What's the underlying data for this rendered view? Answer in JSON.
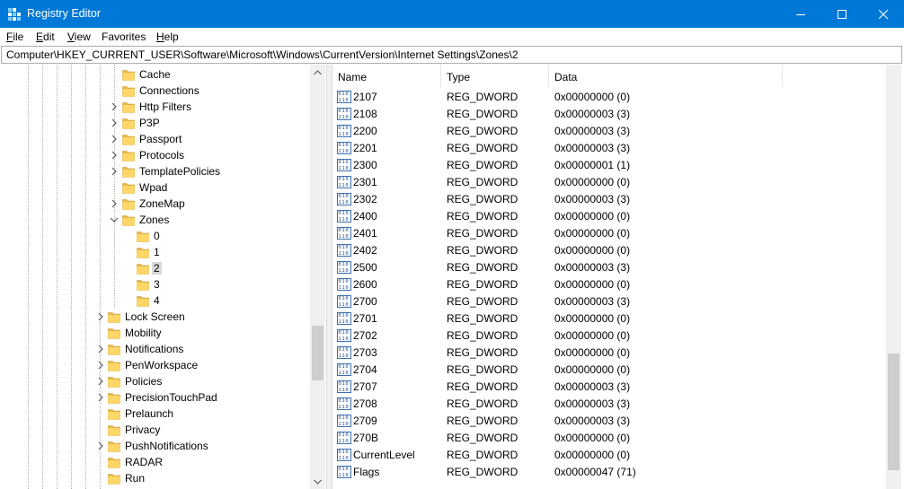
{
  "window": {
    "title": "Registry Editor",
    "controls": {
      "minimize": "minimize",
      "maximize": "maximize",
      "close": "close"
    },
    "accent": "#0078d7"
  },
  "menu": [
    {
      "label": "File",
      "key": "F",
      "rest": "ile"
    },
    {
      "label": "Edit",
      "key": "E",
      "rest": "dit"
    },
    {
      "label": "View",
      "key": "V",
      "rest": "iew"
    },
    {
      "label": "Favorites",
      "key": "F",
      "rest": "avorites",
      "prefix": ""
    },
    {
      "label": "Help",
      "key": "H",
      "rest": "elp"
    }
  ],
  "address": "Computer\\HKEY_CURRENT_USER\\Software\\Microsoft\\Windows\\CurrentVersion\\Internet Settings\\Zones\\2",
  "tree": [
    {
      "label": "Cache",
      "expander": "none",
      "level": 1
    },
    {
      "label": "Connections",
      "expander": "none",
      "level": 1
    },
    {
      "label": "Http Filters",
      "expander": "collapsed",
      "level": 1
    },
    {
      "label": "P3P",
      "expander": "collapsed",
      "level": 1
    },
    {
      "label": "Passport",
      "expander": "collapsed",
      "level": 1
    },
    {
      "label": "Protocols",
      "expander": "collapsed",
      "level": 1
    },
    {
      "label": "TemplatePolicies",
      "expander": "collapsed",
      "level": 1
    },
    {
      "label": "Wpad",
      "expander": "none",
      "level": 1
    },
    {
      "label": "ZoneMap",
      "expander": "collapsed",
      "level": 1
    },
    {
      "label": "Zones",
      "expander": "expanded",
      "level": 1
    },
    {
      "label": "0",
      "expander": "none",
      "level": 2
    },
    {
      "label": "1",
      "expander": "none",
      "level": 2
    },
    {
      "label": "2",
      "expander": "none",
      "level": 2,
      "selected": true
    },
    {
      "label": "3",
      "expander": "none",
      "level": 2
    },
    {
      "label": "4",
      "expander": "none",
      "level": 2
    },
    {
      "label": "Lock Screen",
      "expander": "collapsed",
      "level": 0
    },
    {
      "label": "Mobility",
      "expander": "none",
      "level": 0
    },
    {
      "label": "Notifications",
      "expander": "collapsed",
      "level": 0
    },
    {
      "label": "PenWorkspace",
      "expander": "collapsed",
      "level": 0
    },
    {
      "label": "Policies",
      "expander": "collapsed",
      "level": 0
    },
    {
      "label": "PrecisionTouchPad",
      "expander": "collapsed",
      "level": 0
    },
    {
      "label": "Prelaunch",
      "expander": "none",
      "level": 0
    },
    {
      "label": "Privacy",
      "expander": "none",
      "level": 0
    },
    {
      "label": "PushNotifications",
      "expander": "collapsed",
      "level": 0
    },
    {
      "label": "RADAR",
      "expander": "none",
      "level": 0
    },
    {
      "label": "Run",
      "expander": "none",
      "level": 0
    }
  ],
  "columns": {
    "name": "Name",
    "type": "Type",
    "data": "Data"
  },
  "values": [
    {
      "name": "2107",
      "type": "REG_DWORD",
      "data": "0x00000000 (0)"
    },
    {
      "name": "2108",
      "type": "REG_DWORD",
      "data": "0x00000003 (3)"
    },
    {
      "name": "2200",
      "type": "REG_DWORD",
      "data": "0x00000003 (3)"
    },
    {
      "name": "2201",
      "type": "REG_DWORD",
      "data": "0x00000003 (3)"
    },
    {
      "name": "2300",
      "type": "REG_DWORD",
      "data": "0x00000001 (1)"
    },
    {
      "name": "2301",
      "type": "REG_DWORD",
      "data": "0x00000000 (0)"
    },
    {
      "name": "2302",
      "type": "REG_DWORD",
      "data": "0x00000003 (3)"
    },
    {
      "name": "2400",
      "type": "REG_DWORD",
      "data": "0x00000000 (0)"
    },
    {
      "name": "2401",
      "type": "REG_DWORD",
      "data": "0x00000000 (0)"
    },
    {
      "name": "2402",
      "type": "REG_DWORD",
      "data": "0x00000000 (0)"
    },
    {
      "name": "2500",
      "type": "REG_DWORD",
      "data": "0x00000003 (3)"
    },
    {
      "name": "2600",
      "type": "REG_DWORD",
      "data": "0x00000000 (0)"
    },
    {
      "name": "2700",
      "type": "REG_DWORD",
      "data": "0x00000003 (3)"
    },
    {
      "name": "2701",
      "type": "REG_DWORD",
      "data": "0x00000000 (0)"
    },
    {
      "name": "2702",
      "type": "REG_DWORD",
      "data": "0x00000000 (0)"
    },
    {
      "name": "2703",
      "type": "REG_DWORD",
      "data": "0x00000000 (0)"
    },
    {
      "name": "2704",
      "type": "REG_DWORD",
      "data": "0x00000000 (0)"
    },
    {
      "name": "2707",
      "type": "REG_DWORD",
      "data": "0x00000003 (3)"
    },
    {
      "name": "2708",
      "type": "REG_DWORD",
      "data": "0x00000003 (3)"
    },
    {
      "name": "2709",
      "type": "REG_DWORD",
      "data": "0x00000003 (3)"
    },
    {
      "name": "270B",
      "type": "REG_DWORD",
      "data": "0x00000000 (0)"
    },
    {
      "name": "CurrentLevel",
      "type": "REG_DWORD",
      "data": "0x00000000 (0)"
    },
    {
      "name": "Flags",
      "type": "REG_DWORD",
      "data": "0x00000047 (71)"
    }
  ],
  "scroll": {
    "tree_thumb_fraction": 0.15,
    "list_thumb_fraction": 0.31
  }
}
